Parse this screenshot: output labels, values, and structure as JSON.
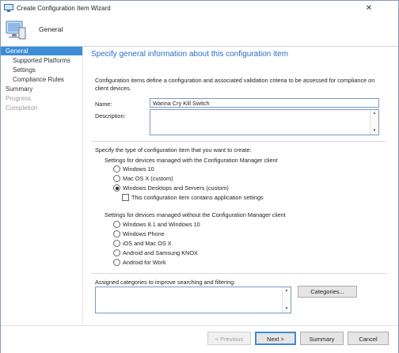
{
  "window": {
    "title": "Create Configuration Item Wizard"
  },
  "header": {
    "page": "General"
  },
  "nav": {
    "items": [
      {
        "label": "General",
        "state": "active"
      },
      {
        "label": "Supported Platforms",
        "state": "normal"
      },
      {
        "label": "Settings",
        "state": "normal"
      },
      {
        "label": "Compliance Rules",
        "state": "normal"
      },
      {
        "label": "Summary",
        "state": "normal"
      },
      {
        "label": "Progress",
        "state": "disabled"
      },
      {
        "label": "Completion",
        "state": "disabled"
      }
    ]
  },
  "main": {
    "title": "Specify general information about this configuration item",
    "intro": "Configuration items define a configuration and associated validation criteria to be assessed for compliance on client devices.",
    "name_label": "Name:",
    "name_value": "Wanna Cry Kill Switch",
    "description_label": "Description:",
    "description_value": "",
    "type_prompt": "Specify the type of configuration item that you want to create:",
    "managed_heading": "Settings for devices managed with the Configuration Manager client",
    "managed_options": [
      {
        "label": "Windows 10",
        "selected": false
      },
      {
        "label": "Mac OS X (custom)",
        "selected": false
      },
      {
        "label": "Windows Desktops and Servers (custom)",
        "selected": true
      }
    ],
    "app_settings_label": "This configuration item contains application settings",
    "app_settings_checked": false,
    "unmanaged_heading": "Settings for devices managed without the Configuration Manager client",
    "unmanaged_options": [
      {
        "label": "Windows 8.1 and Windows 10",
        "selected": false
      },
      {
        "label": "Windows Phone",
        "selected": false
      },
      {
        "label": "iOS and Mac OS X",
        "selected": false
      },
      {
        "label": "Android and Samsung KNOX",
        "selected": false
      },
      {
        "label": "Android for Work",
        "selected": false
      }
    ],
    "categories_label": "Assigned categories to improve searching and filtering:",
    "categories_button": "Categories..."
  },
  "footer": {
    "previous": "< Previous",
    "next": "Next >",
    "summary": "Summary",
    "cancel": "Cancel"
  },
  "colors": {
    "accent": "#3c8dd6",
    "title_blue": "#2a6cc4"
  }
}
